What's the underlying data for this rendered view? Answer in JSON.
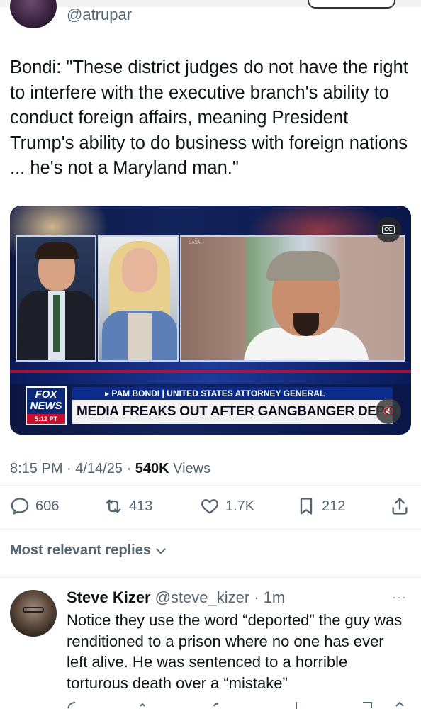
{
  "author": {
    "handle": "@atrupar"
  },
  "tweet": {
    "text": "Bondi: \"These district judges do not have the right to interfere with the executive branch's ability to conduct foreign affairs, meaning President Trump's ability to do business with foreign nations ... he's not a Maryland man.\"",
    "timestamp": "8:15 PM · 4/14/25 · ",
    "views_count": "540K",
    "views_label": " Views"
  },
  "media": {
    "casa_label": "CASA",
    "cc_label": "CC",
    "logo_fox": "FOX",
    "logo_news": "NEWS",
    "logo_time": "5:12 PT",
    "lower_third_label": "▸ PAM BONDI | UNITED STATES ATTORNEY GENERAL",
    "lower_third_headline": "MEDIA FREAKS OUT AFTER GANGBANGER DEPORTED",
    "mute_label": "🔇"
  },
  "actions": {
    "replies": "606",
    "reposts": "413",
    "likes": "1.7K",
    "bookmarks": "212"
  },
  "sort_label": "Most relevant replies",
  "reply": {
    "name": "Steve Kizer",
    "handle": "@steve_kizer",
    "time": "· 1m",
    "more": "···",
    "text": "Notice they use the word “deported” the guy was renditioned to a prison where no one has ever left alive. He was sentenced to a horrible torturous death over a “mistake”"
  },
  "colors": {
    "text": "#0f1419",
    "muted": "#536471",
    "fox_blue": "#0b2c8a",
    "fox_red": "#c8102e"
  }
}
